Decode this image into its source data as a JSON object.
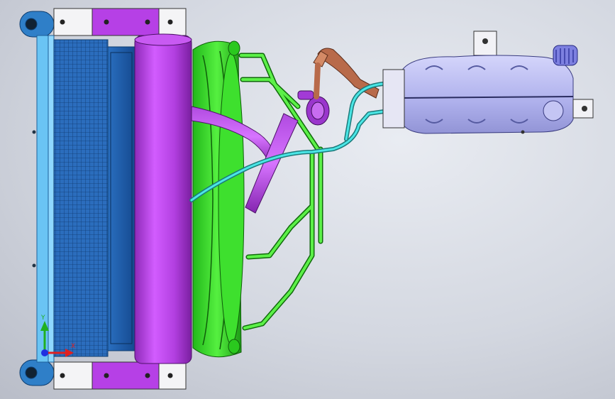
{
  "viewport": {
    "background_top": "#e6e9ef",
    "background_bottom": "#bfc3cd"
  },
  "triad": {
    "x_label": "X",
    "y_label": "Y",
    "x_color": "#e02020",
    "y_color": "#20b020",
    "z_color": "#2030e0"
  },
  "parts": {
    "radiator_core_color": "#1e5aa8",
    "radiator_frame_color": "#5fb8f0",
    "shroud_color": "#b640e6",
    "fan_color": "#33dd22",
    "frame_tube_color": "#44e033",
    "hose_cyan_color": "#3ad6d6",
    "hose_copper_color": "#b86a4a",
    "tank_color": "#b7b8ee"
  }
}
